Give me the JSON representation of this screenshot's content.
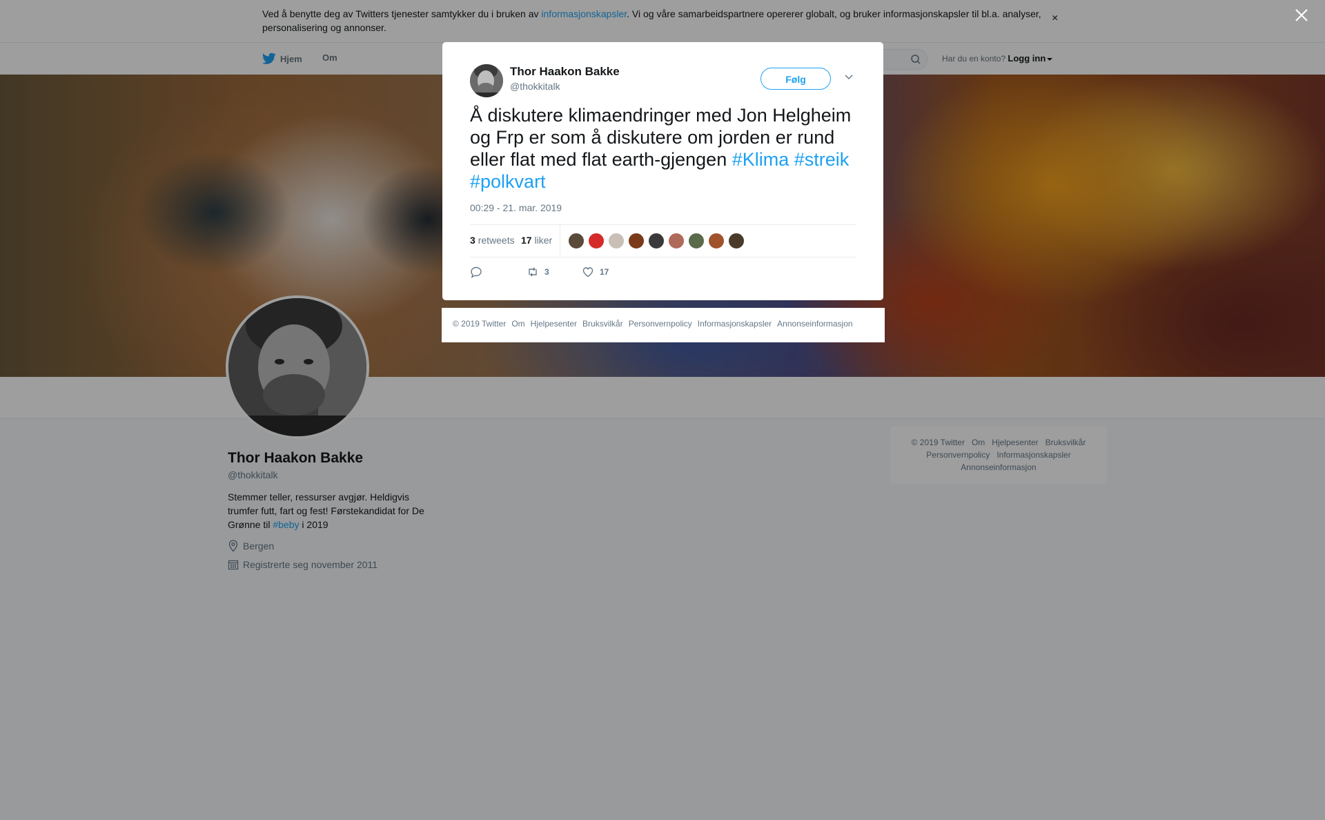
{
  "cookie": {
    "text_before": "Ved å benytte deg av Twitters tjenester samtykker du i bruken av ",
    "link": "informasjonskapsler",
    "text_after": ". Vi og våre samarbeidspartnere opererer globalt, og bruker informasjonskapsler til bl.a. analyser, personalisering og annonser.",
    "close": "×"
  },
  "nav": {
    "home": "Hjem",
    "about": "Om",
    "login_question": "Har du en konto?",
    "login": "Logg inn"
  },
  "profile": {
    "name": "Thor Haakon Bakke",
    "handle": "@thokkitalk",
    "bio_before": "Stemmer teller, ressurser avgjør. Heldigvis trumfer futt, fart og fest! Førstekandidat for De Grønne til ",
    "bio_hashtag": "#beby",
    "bio_after": " i 2019",
    "location": "Bergen",
    "joined": "Registrerte seg november 2011"
  },
  "side_footer": {
    "links": [
      "© 2019 Twitter",
      "Om",
      "Hjelpesenter",
      "Bruksvilkår",
      "Personvernpolicy",
      "Informasjonskapsler",
      "Annonseinformasjon"
    ]
  },
  "tweet": {
    "name": "Thor Haakon Bakke",
    "handle": "@thokkitalk",
    "follow": "Følg",
    "text": "Å diskutere klimaendringer med Jon Helgheim og Frp er som å diskutere om jorden er rund eller flat med flat earth-gjengen ",
    "hashtags": [
      "#Klima",
      "#streik",
      "#polkvart"
    ],
    "timestamp": "00:29 - 21. mar. 2019",
    "retweets_count": "3",
    "retweets_label": "retweets",
    "likes_count": "17",
    "likes_label": "liker",
    "likers": [
      "#5a4a3a",
      "#d42a2a",
      "#c8bfb6",
      "#7a3a1a",
      "#3a3a3a",
      "#b06a5a",
      "#5a6a4a",
      "#a0522d",
      "#4a3a2a"
    ],
    "action_retweets": "3",
    "action_likes": "17"
  },
  "modal_footer": {
    "links": [
      "© 2019 Twitter",
      "Om",
      "Hjelpesenter",
      "Bruksvilkår",
      "Personvernpolicy",
      "Informasjonskapsler",
      "Annonseinformasjon"
    ]
  },
  "colors": {
    "accent": "#1da1f2",
    "text": "#14171a",
    "muted": "#657786"
  }
}
